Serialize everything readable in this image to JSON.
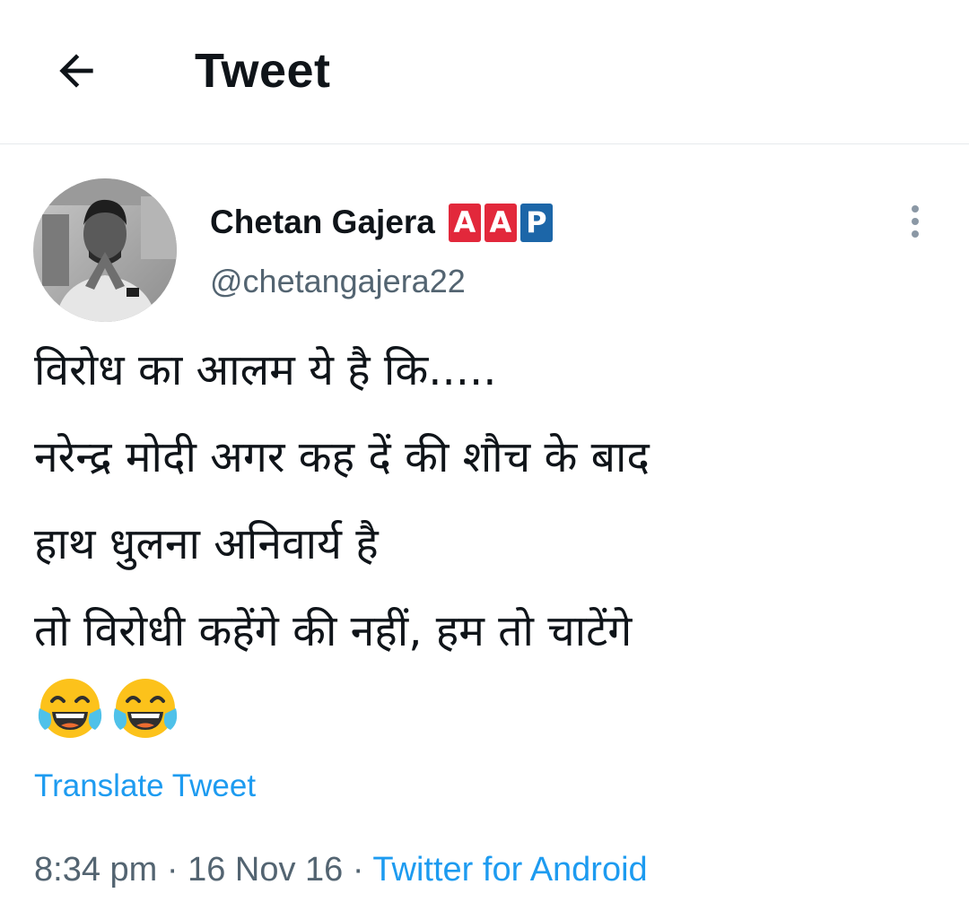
{
  "header": {
    "title": "Tweet",
    "back_icon": "arrow-left-icon"
  },
  "author": {
    "name": "Chetan Gajera",
    "handle": "@chetangajera22",
    "badges": [
      {
        "letter": "A",
        "color": "#e2283b"
      },
      {
        "letter": "A",
        "color": "#e2283b"
      },
      {
        "letter": "P",
        "color": "#1c66a8"
      }
    ],
    "more_icon": "more-vertical-icon"
  },
  "tweet": {
    "lines": [
      "विरोध का आलम ये है कि.....",
      "नरेन्द्र मोदी अगर कह दें की शौच के बाद",
      "हाथ धुलना अनिवार्य है",
      "तो विरोधी कहेंगे की नहीं, हम तो चाटेंगे"
    ],
    "emojis": [
      "face-with-tears-of-joy-icon",
      "face-with-tears-of-joy-icon"
    ]
  },
  "translate_label": "Translate Tweet",
  "meta": {
    "time": "8:34 pm",
    "separator": " · ",
    "date": "16 Nov 16",
    "source": "Twitter for Android"
  },
  "colors": {
    "accent": "#1d9bf0",
    "secondary_text": "#536471",
    "primary_text": "#0f1419"
  }
}
